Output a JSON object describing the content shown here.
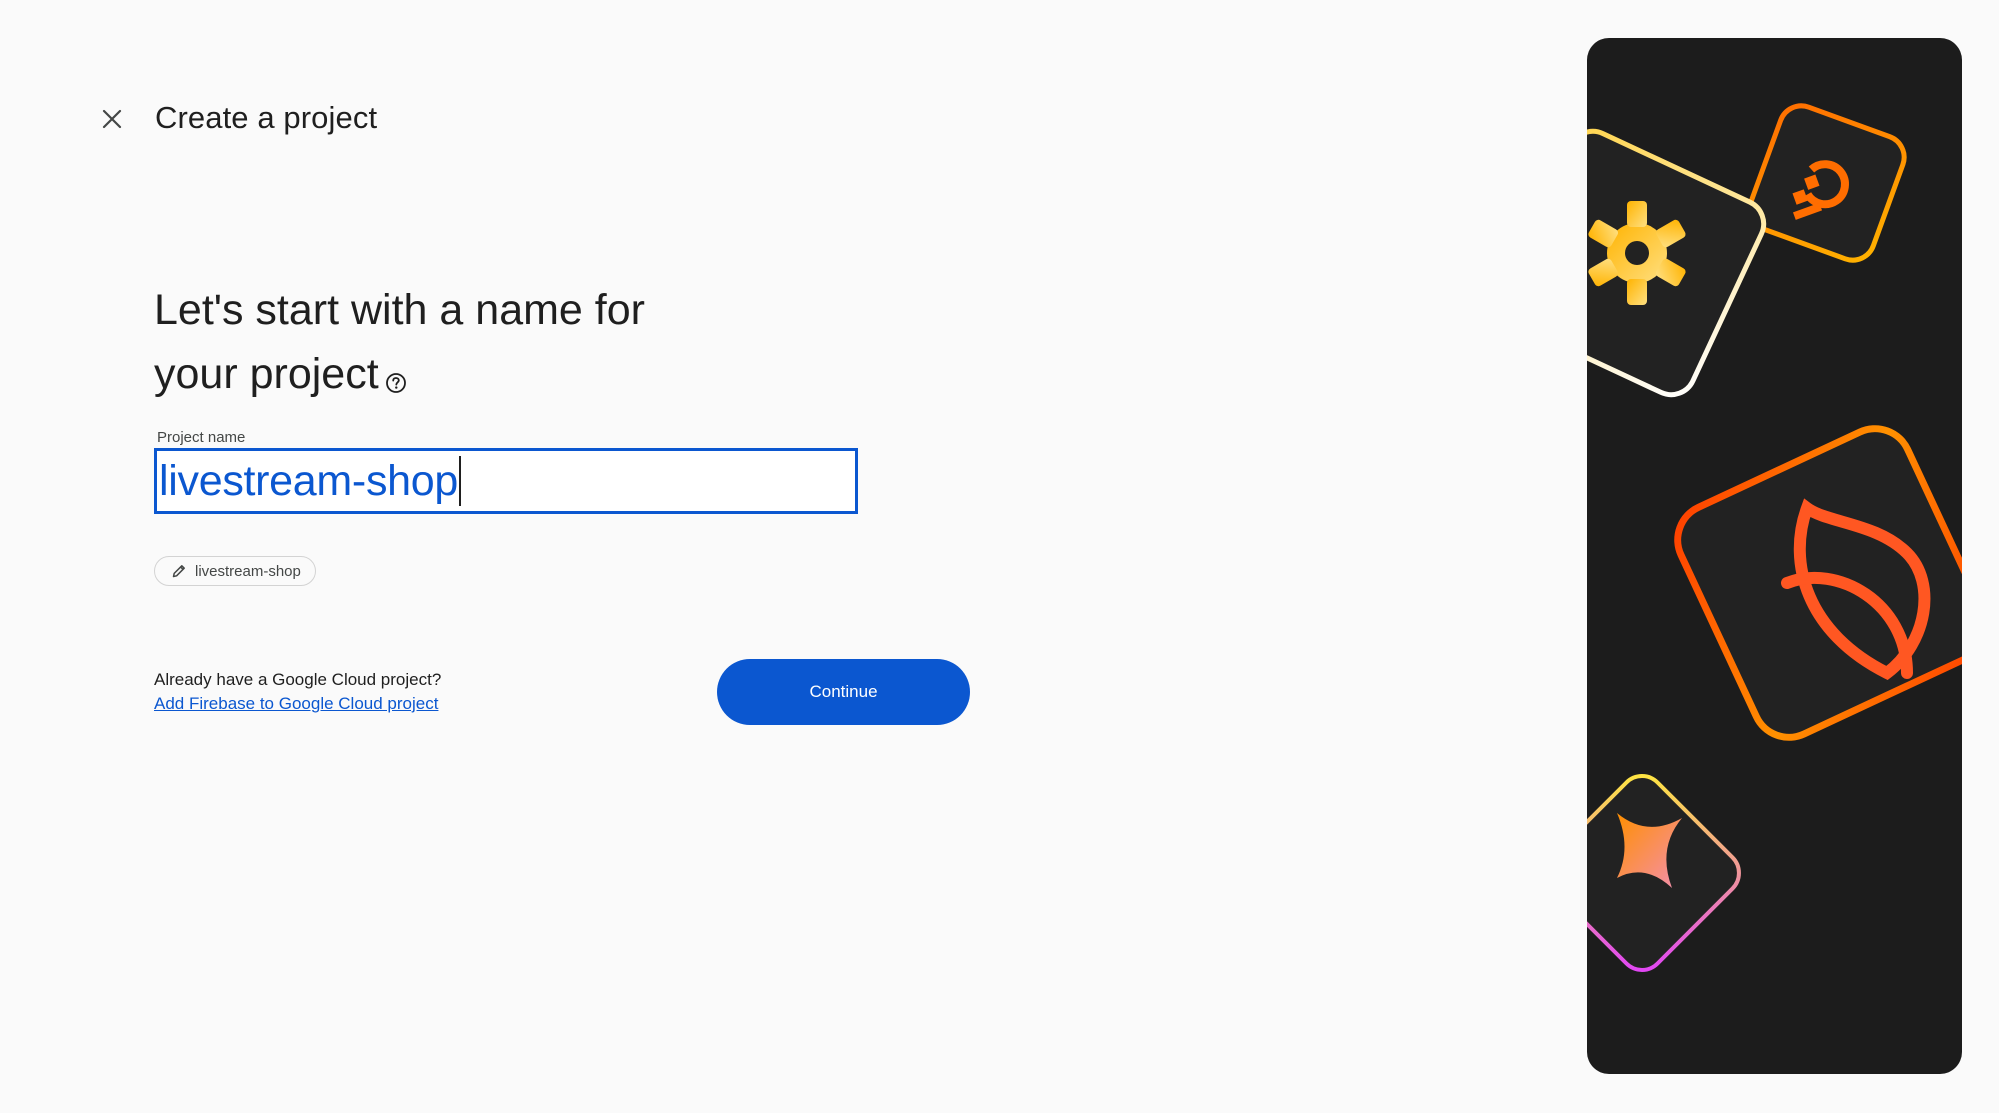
{
  "header": {
    "title": "Create a project"
  },
  "main": {
    "heading_line1": "Let's start with a name for",
    "heading_line2": "your project",
    "field_label": "Project name",
    "field_value": "livestream-shop",
    "project_id": "livestream-shop",
    "existing_prompt": "Already have a Google Cloud project?",
    "existing_link": "Add Firebase to Google Cloud project",
    "continue_label": "Continue"
  },
  "icons": {
    "close": "close-icon",
    "help": "help-icon",
    "edit": "pencil-icon"
  },
  "colors": {
    "accent": "#0b57d0",
    "background": "#fafafa",
    "hero_background": "#1c1c1c"
  }
}
